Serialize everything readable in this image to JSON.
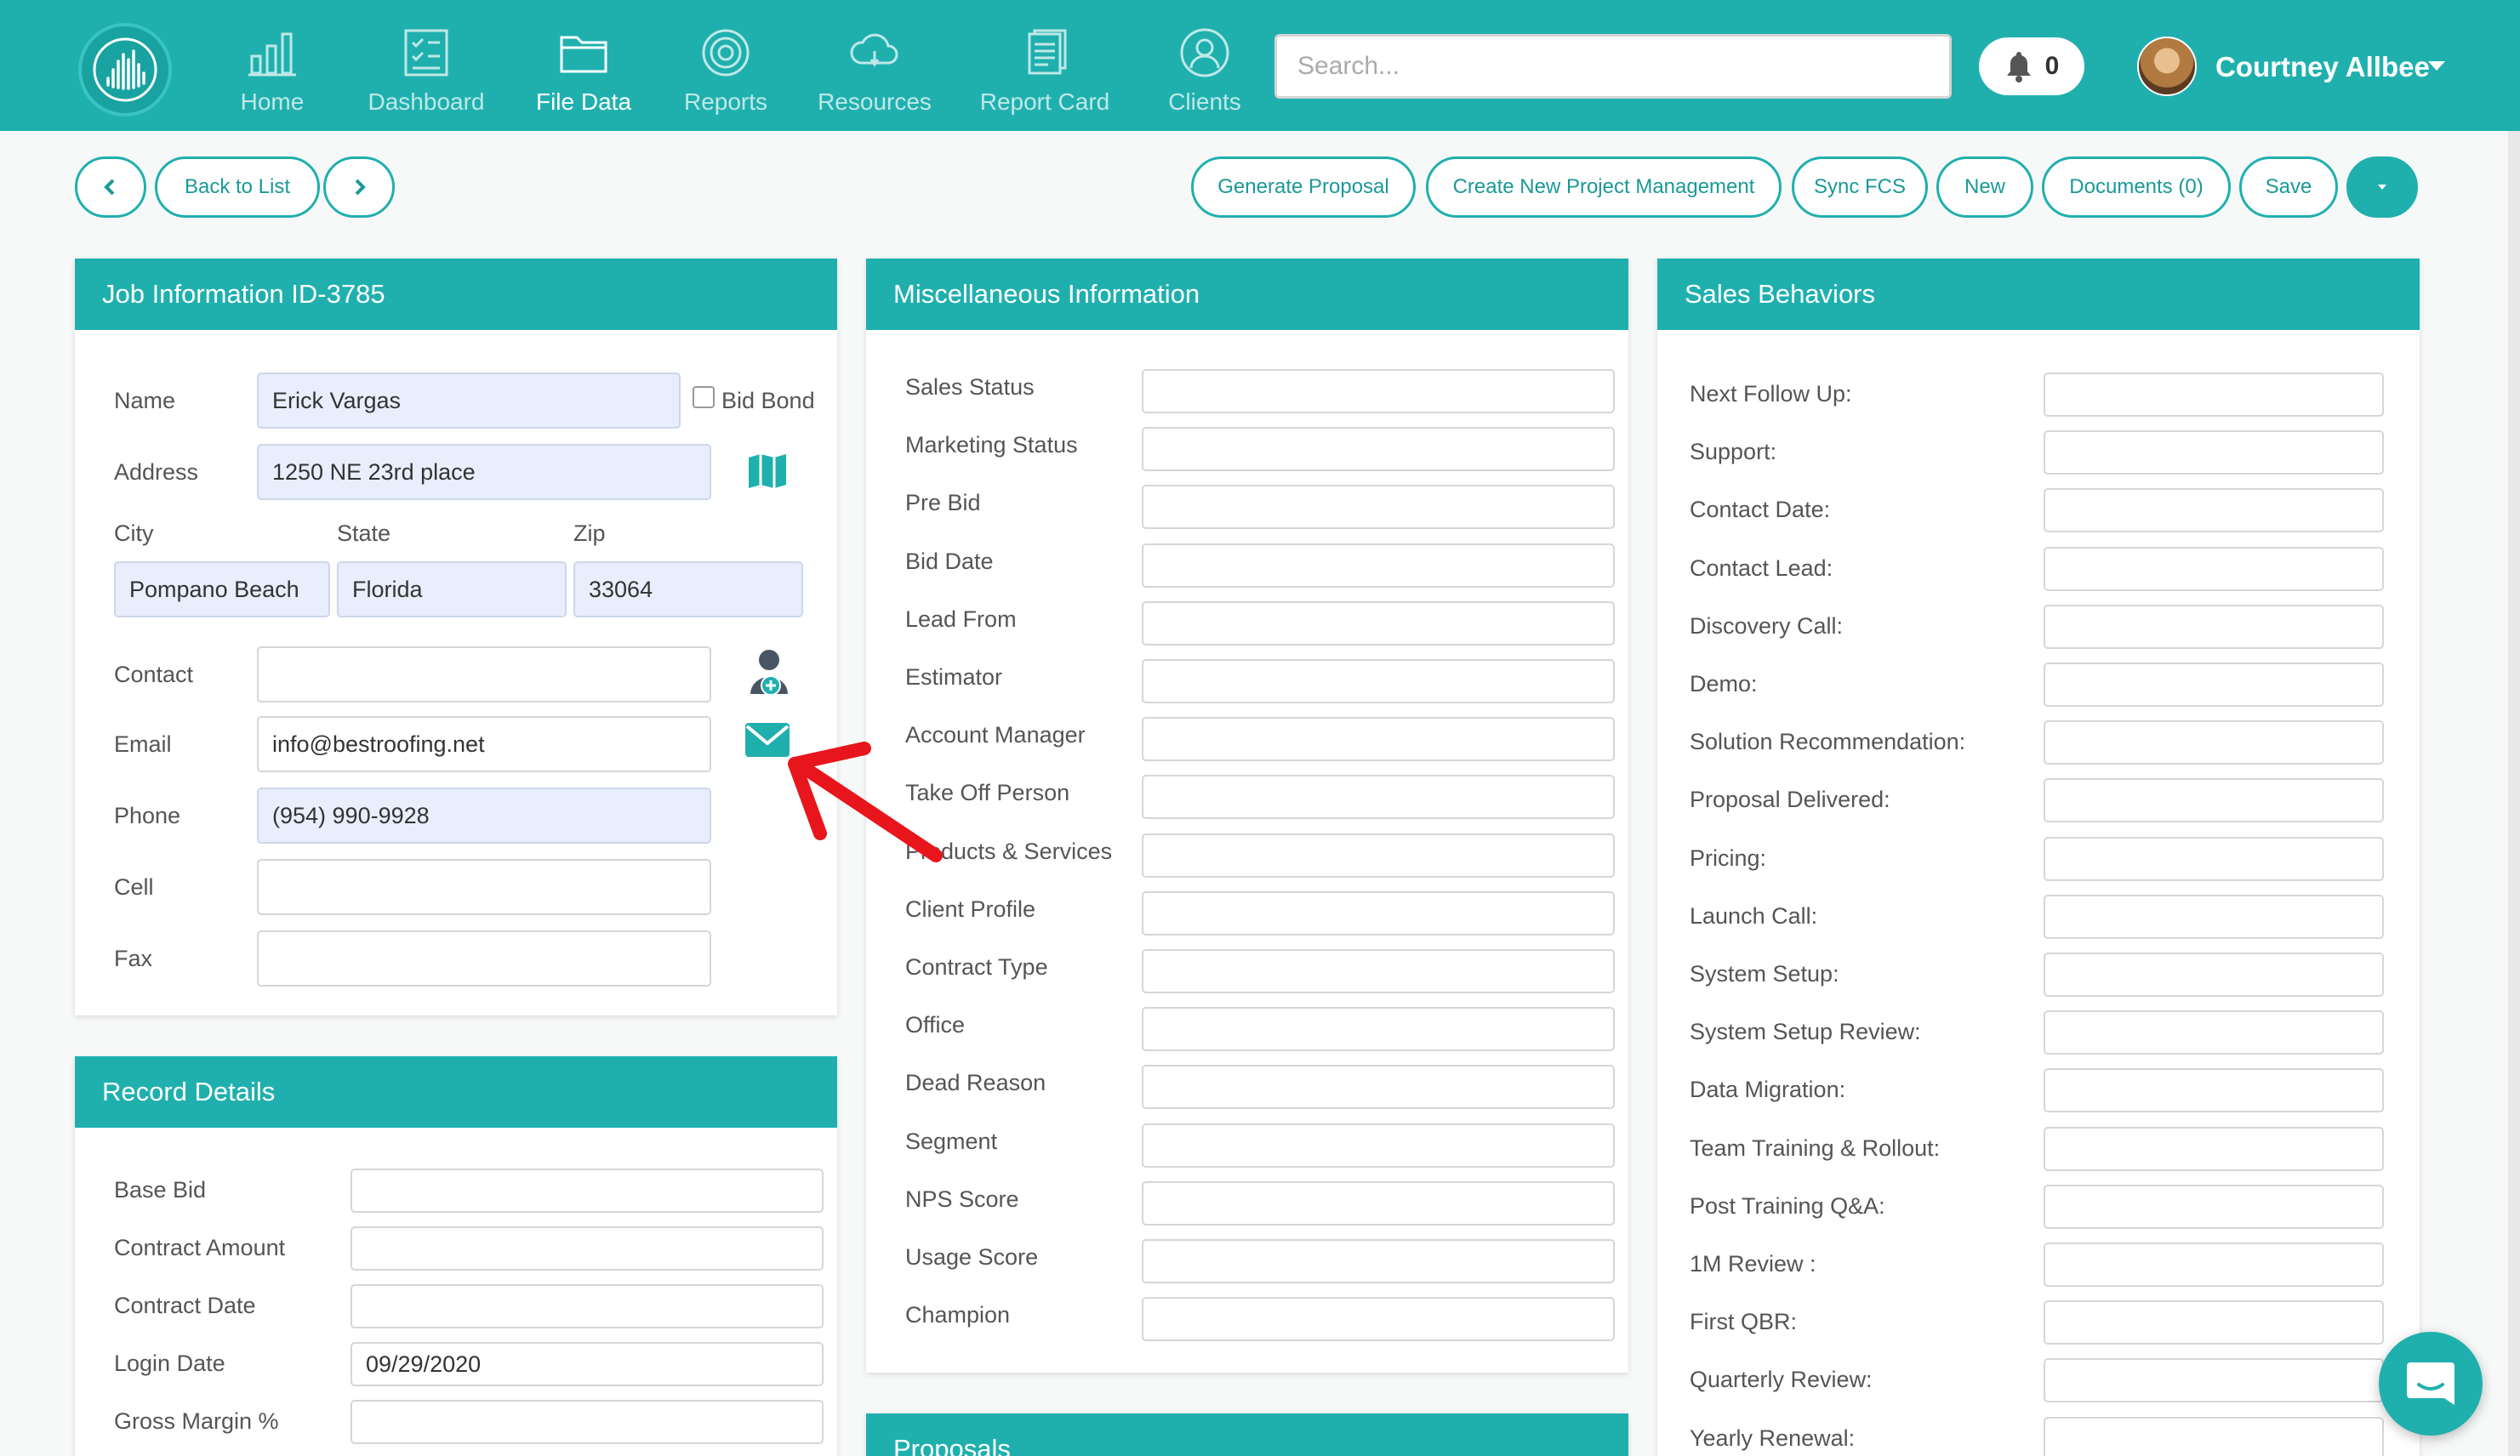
{
  "colors": {
    "teal": "#1fb0ae",
    "arrow": "#e8161c"
  },
  "nav": {
    "items": [
      {
        "label": "Home",
        "icon": "bar-chart-icon"
      },
      {
        "label": "Dashboard",
        "icon": "checklist-icon"
      },
      {
        "label": "File Data",
        "icon": "folder-icon",
        "active": true
      },
      {
        "label": "Reports",
        "icon": "target-icon"
      },
      {
        "label": "Resources",
        "icon": "cloud-icon"
      },
      {
        "label": "Report Card",
        "icon": "document-icon"
      },
      {
        "label": "Clients",
        "icon": "user-circle-icon"
      }
    ],
    "search_placeholder": "Search...",
    "notification_count": "0",
    "user_name": "Courtney Allbee"
  },
  "toolbar": {
    "back_to_list": "Back to List",
    "generate_proposal": "Generate Proposal",
    "create_project": "Create New Project Management",
    "sync_fcs": "Sync FCS",
    "new": "New",
    "documents": "Documents (0)",
    "save": "Save"
  },
  "job": {
    "title": "Job Information ID-3785",
    "name_label": "Name",
    "name_value": "Erick Vargas",
    "bid_bond_label": "Bid Bond",
    "address_label": "Address",
    "address_value": "1250 NE 23rd place",
    "city_label": "City",
    "city_value": "Pompano Beach",
    "state_label": "State",
    "state_value": "Florida",
    "zip_label": "Zip",
    "zip_value": "33064",
    "contact_label": "Contact",
    "contact_value": "",
    "email_label": "Email",
    "email_value": "info@bestroofing.net",
    "phone_label": "Phone",
    "phone_value": "(954) 990-9928",
    "cell_label": "Cell",
    "cell_value": "",
    "fax_label": "Fax",
    "fax_value": ""
  },
  "record": {
    "title": "Record Details",
    "fields": [
      {
        "label": "Base Bid",
        "value": ""
      },
      {
        "label": "Contract Amount",
        "value": ""
      },
      {
        "label": "Contract Date",
        "value": ""
      },
      {
        "label": "Login Date",
        "value": "09/29/2020"
      },
      {
        "label": "Gross Margin %",
        "value": ""
      }
    ]
  },
  "misc": {
    "title": "Miscellaneous Information",
    "fields": [
      "Sales Status",
      "Marketing Status",
      "Pre Bid",
      "Bid Date",
      "Lead From",
      "Estimator",
      "Account Manager",
      "Take Off Person",
      "Products & Services",
      "Client Profile",
      "Contract Type",
      "Office",
      "Dead Reason",
      "Segment",
      "NPS Score",
      "Usage Score",
      "Champion"
    ]
  },
  "proposals": {
    "title": "Proposals"
  },
  "sales": {
    "title": "Sales Behaviors",
    "fields": [
      "Next Follow Up:",
      "Support:",
      "Contact Date:",
      "Contact Lead:",
      "Discovery Call:",
      "Demo:",
      "Solution Recommendation:",
      "Proposal Delivered:",
      "Pricing:",
      "Launch Call:",
      "System Setup:",
      "System Setup Review:",
      "Data Migration:",
      "Team Training & Rollout:",
      "Post Training Q&A:",
      "1M Review :",
      "First QBR:",
      "Quarterly Review:",
      "Yearly Renewal:"
    ]
  }
}
